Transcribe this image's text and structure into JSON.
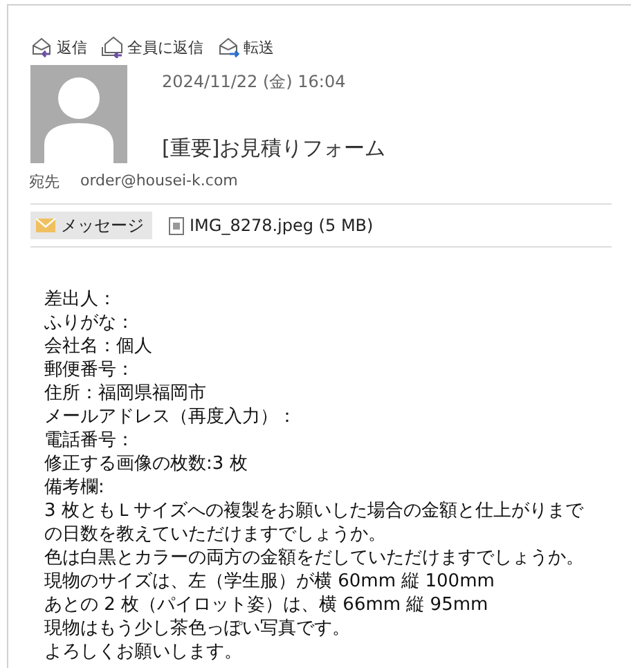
{
  "toolbar": [
    {
      "label": "返信",
      "kind": "reply"
    },
    {
      "label": "全員に返信",
      "kind": "reply_all"
    },
    {
      "label": "転送",
      "kind": "forward"
    }
  ],
  "message": {
    "date": "2024/11/22 (金) 16:04",
    "subject": "[重要]お見積りフォーム",
    "to_label": "宛先",
    "to": "order@housei-k.com"
  },
  "attachments": [
    {
      "label": "メッセージ",
      "kind": "message",
      "selected": true
    },
    {
      "label": "IMG_8278.jpeg (5 MB)",
      "kind": "file",
      "selected": false
    }
  ],
  "body": [
    "差出人：",
    "ふりがな：",
    "会社名：個人",
    "郵便番号：",
    "住所：福岡県福岡市",
    "メールアドレス（再度入力）：",
    "電話番号：",
    "修正する画像の枚数:3 枚",
    "備考欄:",
    "3 枚ともＬサイズへの複製をお願いした場合の金額と仕上がりまで",
    "の日数を教えていただけますでしょうか。",
    "色は白黒とカラーの両方の金額をだしていただけますでしょうか。",
    "現物のサイズは、左（学生服）が横 60mm 縦 100mm",
    "あとの 2 枚（パイロット姿）は、横 66mm 縦 95mm",
    "現物はもう少し茶色っぽい写真です。",
    "よろしくお願いします。"
  ]
}
